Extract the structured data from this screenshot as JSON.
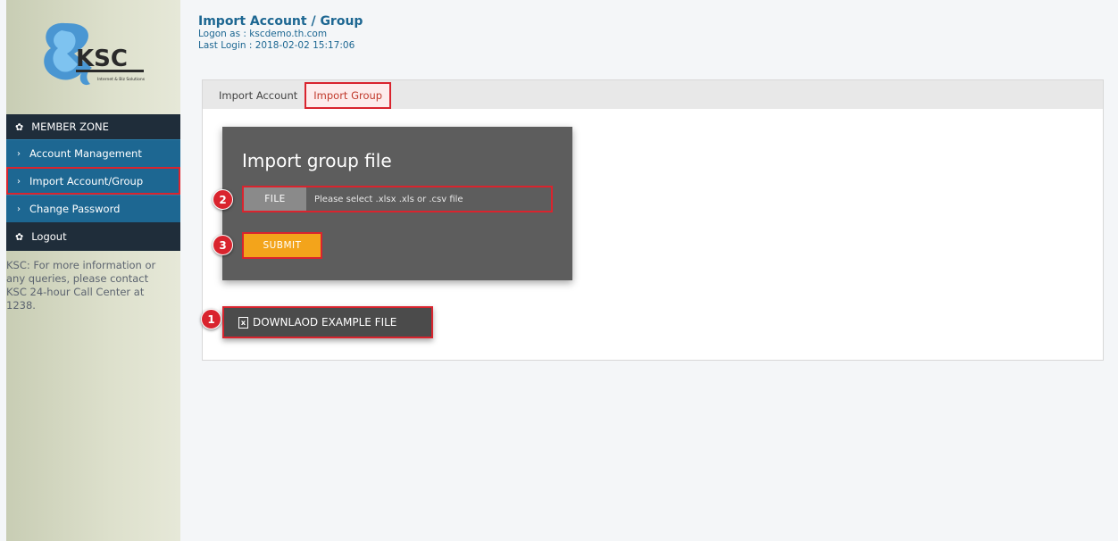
{
  "sidebar": {
    "logo_text": "KSC",
    "logo_tagline": "Internet & Biz Solutions",
    "menu_header": "MEMBER ZONE",
    "items": [
      {
        "label": "Account Management"
      },
      {
        "label": "Import Account/Group"
      },
      {
        "label": "Change Password"
      }
    ],
    "logout": "Logout",
    "note": "KSC: For more information or any queries, please contact KSC 24-hour Call Center at 1238.",
    "icons": {
      "menu_header": "gear-icon",
      "logout": "gear-icon",
      "item": "chevron-right-icon"
    }
  },
  "header": {
    "title": "Import Account / Group",
    "logon": "Logon as : kscdemo.th.com",
    "last_login": "Last Login : 2018-02-02 15:17:06"
  },
  "tabs": [
    {
      "label": "Import Account"
    },
    {
      "label": "Import Group"
    }
  ],
  "import_box": {
    "title": "Import group file",
    "file_button": "FILE",
    "file_placeholder": "Please select .xlsx .xls or .csv file",
    "submit": "SUBMIT"
  },
  "download": {
    "label": "DOWNLAOD EXAMPLE FILE",
    "icon": "excel-file-icon"
  },
  "badges": [
    "1",
    "2",
    "3"
  ],
  "colors": {
    "accent_blue": "#1d6792",
    "dark_nav": "#1f2d3a",
    "highlight_red": "#d9242e",
    "submit_orange": "#f3a41b",
    "box_gray": "#5d5d5d"
  }
}
